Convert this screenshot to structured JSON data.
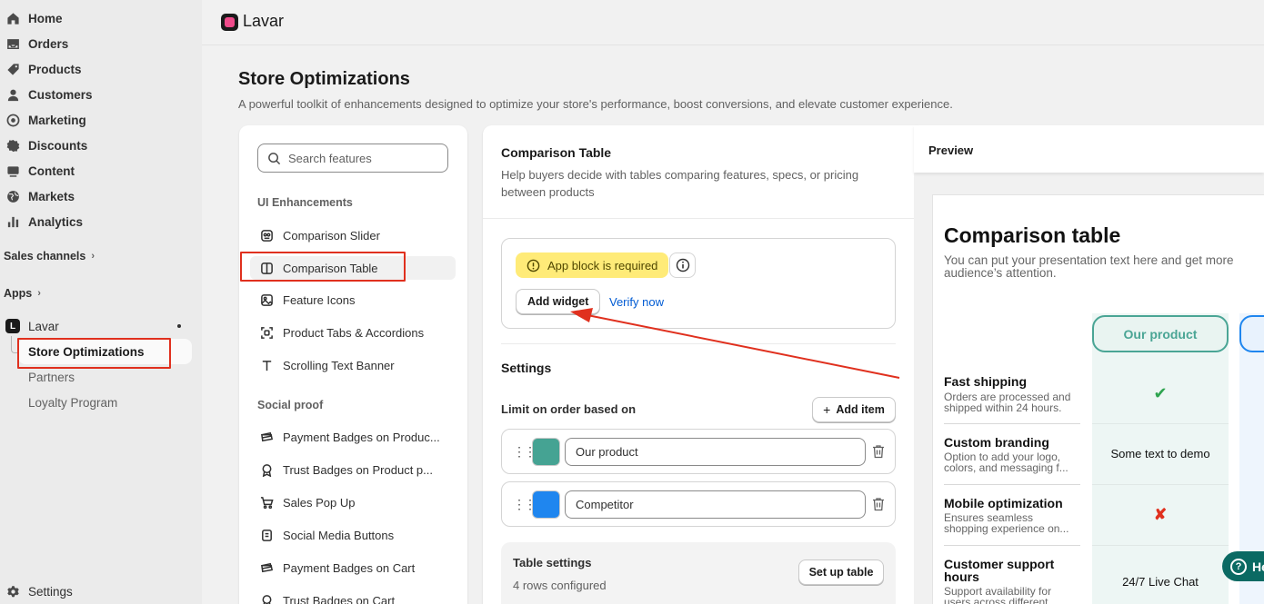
{
  "sidebar": {
    "nav": [
      {
        "label": "Home",
        "icon": "home-icon"
      },
      {
        "label": "Orders",
        "icon": "orders-icon"
      },
      {
        "label": "Products",
        "icon": "tag-icon"
      },
      {
        "label": "Customers",
        "icon": "person-icon"
      },
      {
        "label": "Marketing",
        "icon": "target-icon"
      },
      {
        "label": "Discounts",
        "icon": "discount-icon"
      },
      {
        "label": "Content",
        "icon": "content-icon"
      },
      {
        "label": "Markets",
        "icon": "globe-icon"
      },
      {
        "label": "Analytics",
        "icon": "bar-chart-icon"
      }
    ],
    "sales_channels": "Sales channels",
    "apps": "Apps",
    "app_name": "Lavar",
    "app_items": [
      "Store Optimizations",
      "Partners",
      "Loyalty Program"
    ],
    "settings": "Settings"
  },
  "header": {
    "app_title": "Lavar"
  },
  "page": {
    "title": "Store Optimizations",
    "subtitle": "A powerful toolkit of enhancements designed to optimize your store's performance, boost conversions, and elevate customer experience."
  },
  "features": {
    "search_placeholder": "Search features",
    "groups": [
      {
        "title": "UI Enhancements",
        "items": [
          "Comparison Slider",
          "Comparison Table",
          "Feature Icons",
          "Product Tabs & Accordions",
          "Scrolling Text Banner"
        ]
      },
      {
        "title": "Social proof",
        "items": [
          "Payment Badges on Produc...",
          "Trust Badges on Product p...",
          "Sales Pop Up",
          "Social Media Buttons",
          "Payment Badges on Cart",
          "Trust Badges on Cart"
        ]
      }
    ],
    "selected": "Comparison Table"
  },
  "detail": {
    "title": "Comparison Table",
    "description": "Help buyers decide with tables comparing features, specs, or pricing between products",
    "app_block_badge": "App block is required",
    "add_widget": "Add widget",
    "verify_now": "Verify now",
    "settings_title": "Settings",
    "limit_label": "Limit on order based on",
    "add_item": "Add item",
    "items": [
      {
        "value": "Our product",
        "color": "#45a393"
      },
      {
        "value": "Competitor",
        "color": "#1f86ef"
      }
    ],
    "table_settings_title": "Table settings",
    "table_settings_sub": "4 rows configured",
    "setup_table": "Set up table"
  },
  "preview": {
    "label": "Preview",
    "title": "Comparison table",
    "description": "You can put your presentation text here and get more audience’s attention.",
    "our_product_header": "Our product",
    "rows": [
      {
        "title": "Fast shipping",
        "desc": "Orders are processed and shipped within 24 hours.",
        "value": "✔"
      },
      {
        "title": "Custom branding",
        "desc": "Option to add your logo, colors, and messaging f...",
        "value": "Some text to demo"
      },
      {
        "title": "Mobile optimization",
        "desc": "Ensures seamless shopping experience on...",
        "value": "✘"
      },
      {
        "title": "Customer support hours",
        "desc": "Support availability for users across different...",
        "value": "24/7 Live Chat"
      }
    ],
    "check_color": "#2ea44f",
    "cross_color": "#e0301e"
  },
  "help": {
    "label": "He"
  },
  "colors": {
    "annotation_red": "#e0301e",
    "brand_pink": "#ef4a8a"
  }
}
